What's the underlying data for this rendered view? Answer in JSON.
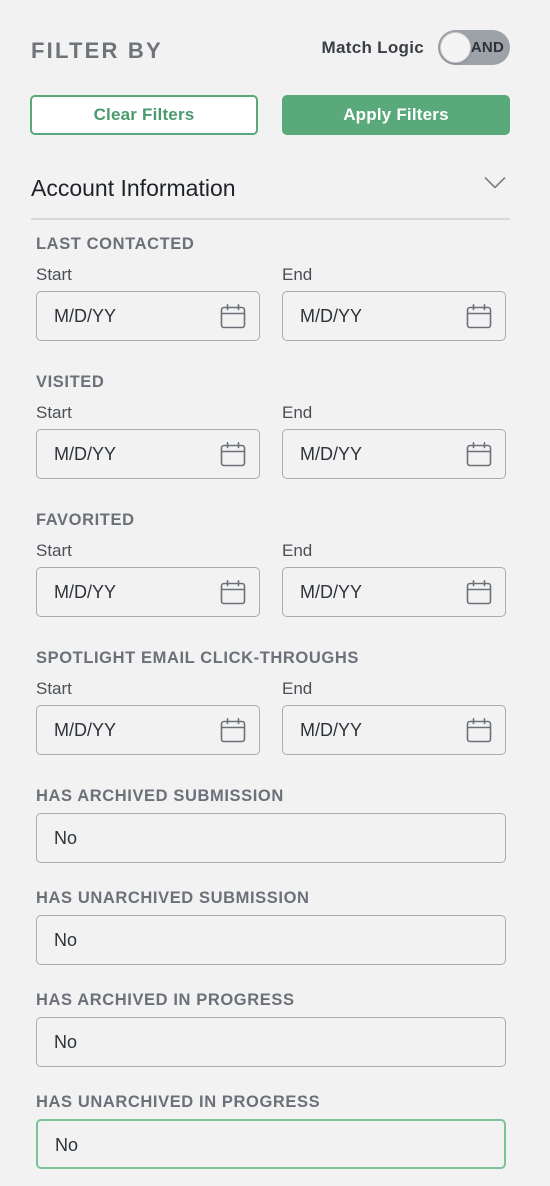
{
  "header": {
    "title": "FILTER BY",
    "match_logic_label": "Match Logic",
    "match_logic_value": "AND"
  },
  "actions": {
    "clear_label": "Clear Filters",
    "apply_label": "Apply Filters"
  },
  "section": {
    "title": "Account Information",
    "expand_icon": "chevron-down-icon"
  },
  "date_groups": [
    {
      "label": "LAST CONTACTED",
      "start_label": "Start",
      "end_label": "End",
      "start_placeholder": "M/D/YY",
      "end_placeholder": "M/D/YY"
    },
    {
      "label": "VISITED",
      "start_label": "Start",
      "end_label": "End",
      "start_placeholder": "M/D/YY",
      "end_placeholder": "M/D/YY"
    },
    {
      "label": "FAVORITED",
      "start_label": "Start",
      "end_label": "End",
      "start_placeholder": "M/D/YY",
      "end_placeholder": "M/D/YY"
    },
    {
      "label": "SPOTLIGHT EMAIL CLICK-THROUGHS",
      "start_label": "Start",
      "end_label": "End",
      "start_placeholder": "M/D/YY",
      "end_placeholder": "M/D/YY"
    }
  ],
  "select_groups": [
    {
      "label": "HAS ARCHIVED SUBMISSION",
      "value": "No"
    },
    {
      "label": "HAS UNARCHIVED SUBMISSION",
      "value": "No"
    },
    {
      "label": "HAS ARCHIVED IN PROGRESS",
      "value": "No"
    },
    {
      "label": "HAS UNARCHIVED IN PROGRESS",
      "value": "No"
    }
  ],
  "colors": {
    "accent_green": "#5aa97a",
    "focus_green": "#7cc497",
    "toggle_gray": "#9da2a9",
    "background": "#f2f2f2"
  },
  "icons": {
    "date_picker": "calendar-icon",
    "toggle": "toggle-switch"
  }
}
